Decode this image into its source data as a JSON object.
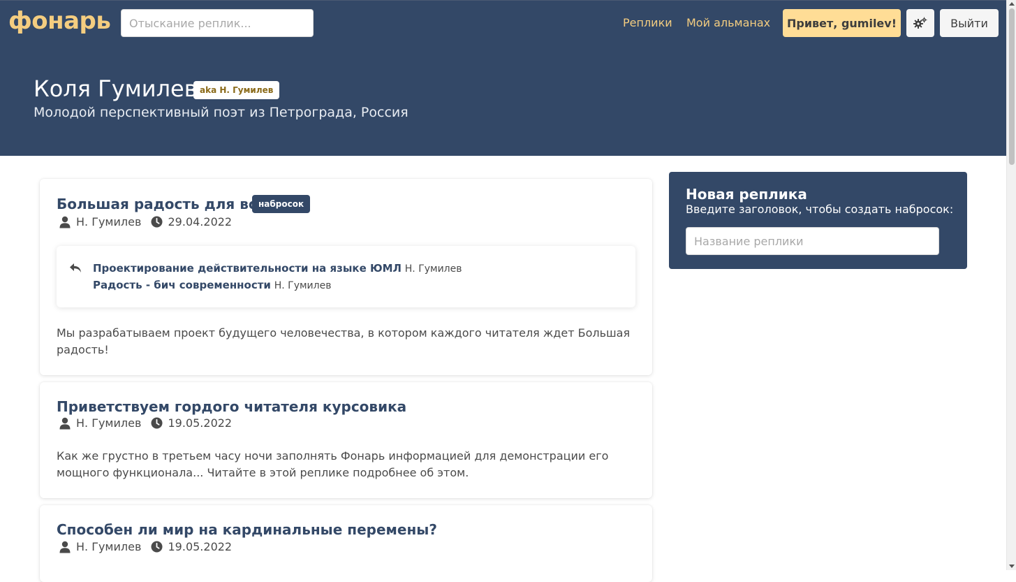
{
  "navbar": {
    "brand": "фонарь",
    "search_placeholder": "Отыскание реплик...",
    "links": [
      "Реплики",
      "Мой альманах"
    ],
    "hello_button": "Привет, gumilev!",
    "settings_icon": "gears-icon",
    "logout_button": "Выйти"
  },
  "profile": {
    "name": "Коля Гумилев",
    "aka": "aka Н. Гумилев",
    "description": "Молодой перспективный поэт из Петрограда, Россия"
  },
  "posts": [
    {
      "title": "Большая радость для всех!",
      "tag": "набросок",
      "author": "Н. Гумилев",
      "date": "29.04.2022",
      "replies": [
        {
          "title": "Проектирование действительности на языке ЮМЛ",
          "author": "Н. Гумилев"
        },
        {
          "title": "Радость - бич современности",
          "author": "Н. Гумилев"
        }
      ],
      "text": "Мы разрабатываем проект будущего человечества, в котором каждого читателя ждет Большая радость!"
    },
    {
      "title": "Приветствуем гордого читателя курсовика",
      "author": "Н. Гумилев",
      "date": "19.05.2022",
      "text": "Как же грустно в третьем часу ночи заполнять Фонарь информацией для демонстрации его мощного функционала... Читайте в этой реплике подробнее об этом."
    },
    {
      "title": "Способен ли мир на кардинальные перемены?",
      "author": "Н. Гумилев",
      "date": "19.05.2022"
    }
  ],
  "sidebar": {
    "title": "Новая реплика",
    "subtitle": "Введите заголовок, чтобы создать набросок:",
    "input_placeholder": "Название реплики"
  },
  "colors": {
    "primary": "#334867",
    "accent": "#f4cd80",
    "hello_button": "#ffdd96"
  }
}
